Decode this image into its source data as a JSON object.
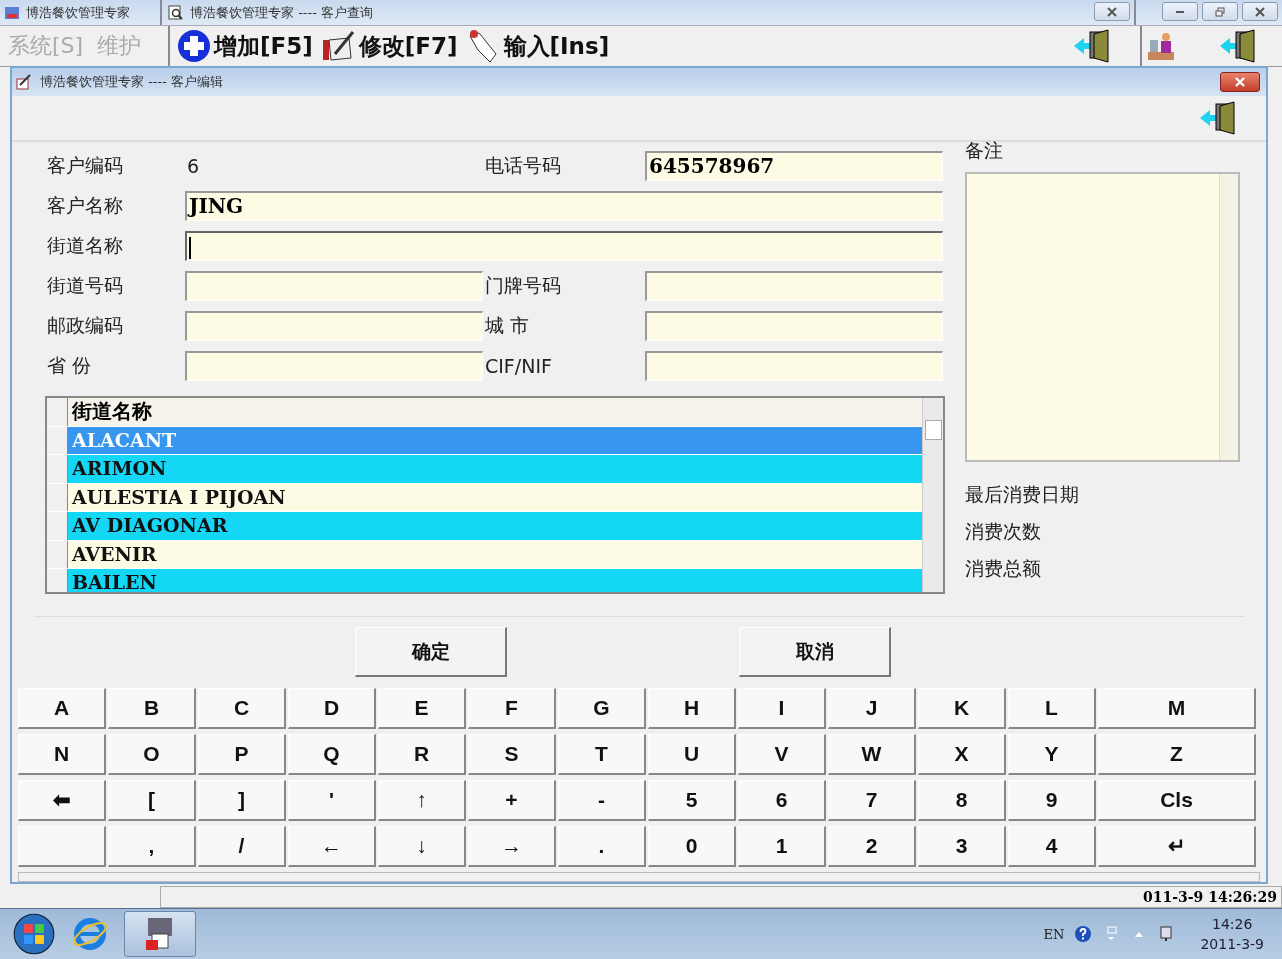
{
  "app": {
    "title": "博浩餐饮管理专家",
    "menu": [
      {
        "label": "系统[S]",
        "disabled": true
      },
      {
        "label": "维护",
        "disabled": true
      }
    ],
    "status_time": "011-3-9 14:26:29"
  },
  "query_window": {
    "title": "博浩餐饮管理专家 ---- 客户查询",
    "toolbar": [
      {
        "kind": "add",
        "label": "增加[F5]"
      },
      {
        "kind": "edit",
        "label": "修改[F7]"
      },
      {
        "kind": "input",
        "label": "输入[Ins]"
      }
    ]
  },
  "dialog": {
    "title": "博浩餐饮管理专家 ---- 客户编辑",
    "form_rows": [
      [
        {
          "label": "客户编码",
          "kind": "static",
          "value": "6"
        },
        {
          "label": "电话号码",
          "kind": "input",
          "value": "645578967"
        }
      ],
      [
        {
          "label": "客户名称",
          "kind": "input",
          "value": "JING"
        }
      ],
      [
        {
          "label": "街道名称",
          "kind": "input",
          "focused": true
        }
      ],
      [
        {
          "label": "街道号码",
          "kind": "input"
        },
        {
          "label": "门牌号码",
          "kind": "input"
        }
      ],
      [
        {
          "label": "邮政编码",
          "kind": "input"
        },
        {
          "label": "城 市",
          "kind": "input"
        }
      ],
      [
        {
          "label": "省 份",
          "kind": "input"
        },
        {
          "label": "CIF/NIF",
          "kind": "input"
        }
      ]
    ],
    "notes": {
      "label": "备注"
    },
    "stats": [
      "最后消费日期",
      "消费次数",
      "消费总额"
    ],
    "street_list": {
      "column": "街道名称",
      "rows": [
        {
          "name": "ALACANT",
          "selected": true
        },
        {
          "name": "ARIMON",
          "selected": false
        },
        {
          "name": "AULESTIA I PIJOAN",
          "selected": false
        },
        {
          "name": "AV DIAGONAR",
          "selected": false
        },
        {
          "name": "AVENIR",
          "selected": false
        },
        {
          "name": "BAILEN",
          "selected": false
        }
      ]
    },
    "buttons": [
      "确定",
      "取消"
    ],
    "keyboard": [
      [
        "A",
        "B",
        "C",
        "D",
        "E",
        "F",
        "G",
        "H",
        "I",
        "J",
        "K",
        "L",
        "M"
      ],
      [
        "N",
        "O",
        "P",
        "Q",
        "R",
        "S",
        "T",
        "U",
        "V",
        "W",
        "X",
        "Y",
        "Z"
      ],
      [
        "⬅",
        "[",
        "]",
        "'",
        "↑",
        "+",
        "-",
        "5",
        "6",
        "7",
        "8",
        "9",
        "Cls"
      ],
      [
        ",",
        "/",
        "←",
        "↓",
        "→",
        ".",
        "0",
        "1",
        "2",
        "3",
        "4",
        "↵"
      ]
    ]
  },
  "taskbar": {
    "language": "EN",
    "time": "14:26",
    "date": "2011-3-9"
  }
}
